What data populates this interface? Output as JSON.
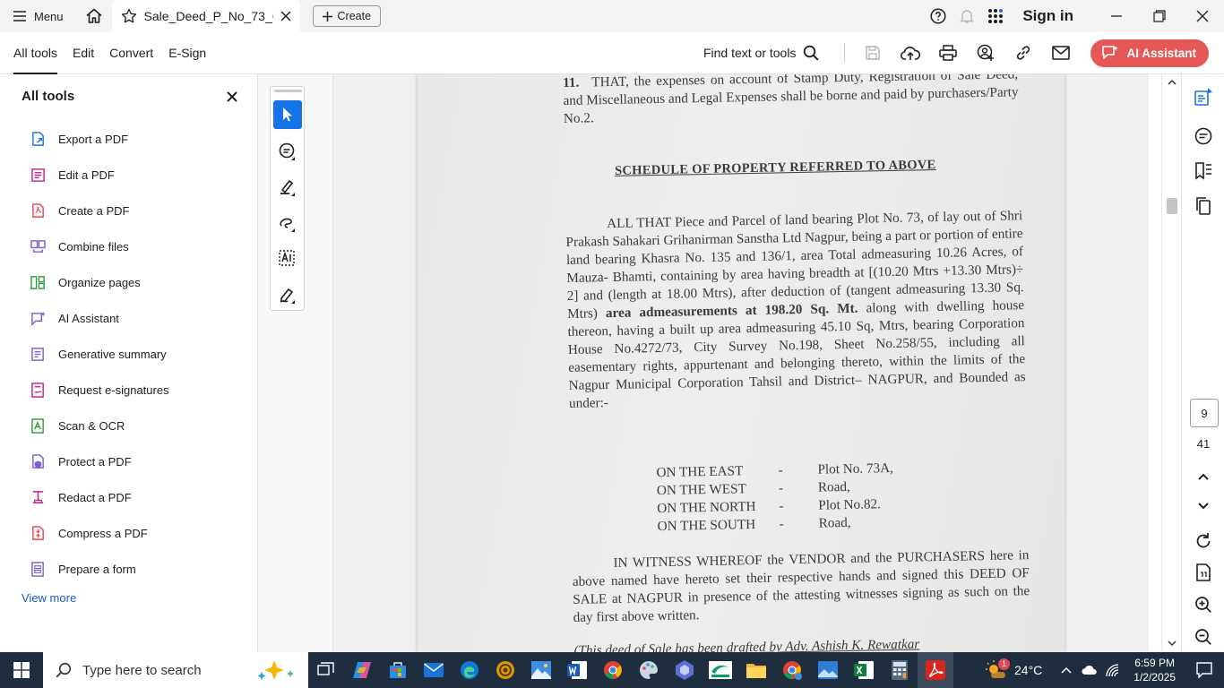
{
  "titlebar": {
    "menu_label": "Menu",
    "tab_title": "Sale_Deed_P_No_73_G...",
    "create_label": "Create",
    "sign_in": "Sign in"
  },
  "toolbar": {
    "tabs": [
      "All tools",
      "Edit",
      "Convert",
      "E-Sign"
    ],
    "find_label": "Find text or tools",
    "ai_assistant": "AI Assistant"
  },
  "left_panel": {
    "title": "All tools",
    "items": [
      {
        "label": "Export a PDF",
        "icon": "export-pdf-icon",
        "color": "#1473e6"
      },
      {
        "label": "Edit a PDF",
        "icon": "edit-pdf-icon",
        "color": "#c01e8d"
      },
      {
        "label": "Create a PDF",
        "icon": "create-pdf-icon",
        "color": "#e34850"
      },
      {
        "label": "Combine files",
        "icon": "combine-files-icon",
        "color": "#7e5bd3"
      },
      {
        "label": "Organize pages",
        "icon": "organize-pages-icon",
        "color": "#2d9d3a"
      },
      {
        "label": "AI Assistant",
        "icon": "ai-assistant-icon",
        "color": "#7e5bd3"
      },
      {
        "label": "Generative summary",
        "icon": "generative-summary-icon",
        "color": "#7e5bd3"
      },
      {
        "label": "Request e-signatures",
        "icon": "request-esignatures-icon",
        "color": "#c01e8d"
      },
      {
        "label": "Scan & OCR",
        "icon": "scan-ocr-icon",
        "color": "#2d9d3a"
      },
      {
        "label": "Protect a PDF",
        "icon": "protect-pdf-icon",
        "color": "#7e5bd3"
      },
      {
        "label": "Redact a PDF",
        "icon": "redact-pdf-icon",
        "color": "#c01e8d"
      },
      {
        "label": "Compress a PDF",
        "icon": "compress-pdf-icon",
        "color": "#e34850"
      },
      {
        "label": "Prepare a form",
        "icon": "prepare-form-icon",
        "color": "#7e5bd3"
      }
    ],
    "view_more": "View more"
  },
  "document": {
    "clause_11_number": "11.",
    "clause_11_text": "THAT, the expenses on account of Stamp Duty, Registration of Sale Deed, and Miscellaneous and Legal Expenses shall be borne and paid by purchasers/Party No.2.",
    "schedule_heading": "SCHEDULE OF PROPERTY REFERRED TO ABOVE",
    "schedule_part1": "ALL THAT Piece and Parcel of land bearing Plot No. 73, of lay out of Shri Prakash Sahakari Grihanirman Sanstha Ltd Nagpur, being a part or portion of entire land bearing Khasra No. 135 and 136/1, area Total admeasuring 10.26 Acres, of Mauza- Bhamti, containing by area having breadth at [(10.20 Mtrs +13.30 Mtrs)÷ 2] and (length at 18.00 Mtrs), after deduction of (tangent admeasuring 13.30 Sq. Mtrs) ",
    "schedule_bold": "area admeasurements at 198.20 Sq. Mt.",
    "schedule_part2": " along with dwelling house thereon, having a built up area admeasuring 45.10 Sq, Mtrs, bearing Corporation House No.4272/73, City Survey No.198, Sheet No.258/55, including all easementary rights, appurtenant and belonging thereto, within the limits of the Nagpur Municipal Corporation Tahsil and District– NAGPUR, and Bounded as under:-",
    "bounds": [
      {
        "dir": "ON THE EAST",
        "dash": "-",
        "value": "Plot No. 73A,"
      },
      {
        "dir": "ON THE WEST",
        "dash": "-",
        "value": "Road,"
      },
      {
        "dir": "ON THE NORTH",
        "dash": "-",
        "value": "Plot No.82."
      },
      {
        "dir": "ON THE SOUTH",
        "dash": "-",
        "value": "Road,"
      }
    ],
    "witness_text": "IN WITNESS WHEREOF the VENDOR and the PURCHASERS here in above named have hereto set their respective hands and signed this DEED OF SALE at NAGPUR in presence of the attesting witnesses signing as such on the day first above written.",
    "drafted_text": "(This deed of Sale has been drafted by Adv. Ashish K. Rewatkar"
  },
  "navigation": {
    "current_page": "9",
    "total_pages": "41"
  },
  "taskbar": {
    "search_placeholder": "Type here to search",
    "temperature": "24°C",
    "weather_badge": "1",
    "time": "6:59 PM",
    "date": "1/2/2025"
  },
  "colors": {
    "accent_blue": "#1473e6",
    "ai_button": "#e65857",
    "taskbar": "#1f2e3f"
  }
}
